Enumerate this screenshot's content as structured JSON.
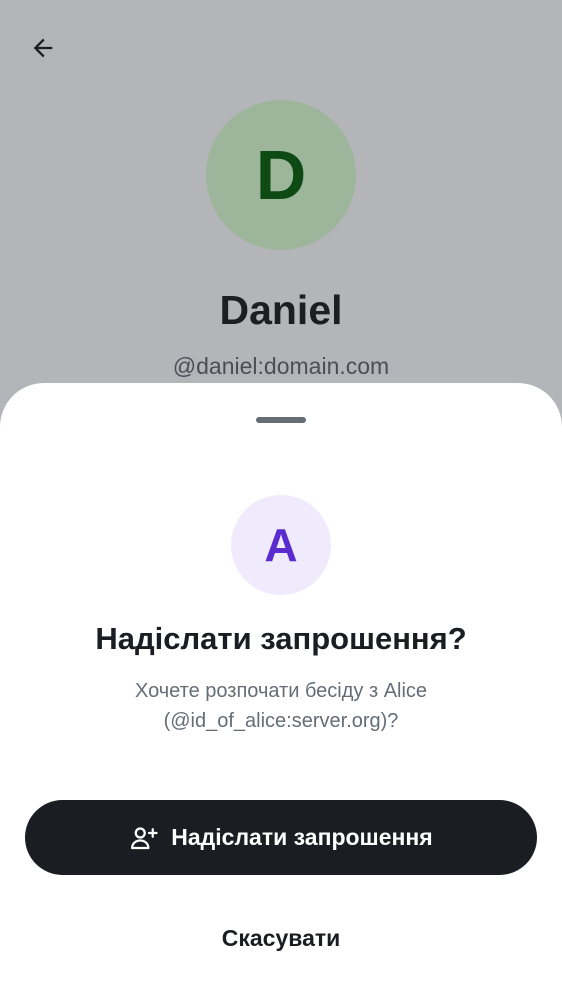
{
  "profile": {
    "avatar_initial": "D",
    "name": "Daniel",
    "handle": "@daniel:domain.com",
    "back_icon": "arrow-left-icon"
  },
  "sheet": {
    "avatar_initial": "A",
    "title": "Надіслати запрошення?",
    "description": "Хочете розпочати бесіду з Alice (@id_of_alice:server.org)?",
    "primary_button": {
      "label": "Надіслати запрошення",
      "icon": "user-add-icon"
    },
    "cancel_button": {
      "label": "Скасувати"
    }
  },
  "colors": {
    "scrim_background": "#b4b5b8",
    "profile_avatar_bg": "#9db59a",
    "profile_avatar_fg": "#0d4a14",
    "invite_avatar_bg": "#efebfd",
    "invite_avatar_fg": "#5a2bcf",
    "primary_button_bg": "#1b1d22",
    "text_secondary": "#656d77"
  }
}
